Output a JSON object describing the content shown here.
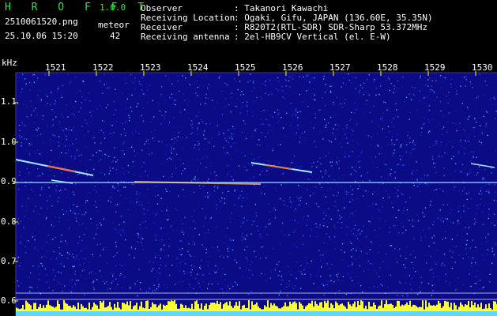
{
  "header": {
    "app_title": "H R O F F T",
    "version": "1.0.0",
    "filename": "2510061520.png",
    "datetime": "25.10.06 15:20",
    "meteor_label": "meteor",
    "meteor_count": "42"
  },
  "info": [
    {
      "label": "Observer",
      "value": ": Takanori Kawachi"
    },
    {
      "label": "Receiving Location",
      "value": ": Ogaki, Gifu, JAPAN (136.60E, 35.35N)"
    },
    {
      "label": "Receiver",
      "value": ": R820T2(RTL-SDR) SDR-Sharp 53.372MHz"
    },
    {
      "label": "Receiving antenna",
      "value": ": 2el-HB9CV Vertical (el. E-W)"
    }
  ],
  "axis": {
    "unit": "kHz",
    "time_ticks": [
      "1521",
      "1522",
      "1523",
      "1524",
      "1525",
      "1526",
      "1527",
      "1528",
      "1529",
      "1530"
    ],
    "freq_ticks": [
      "1.1",
      "1.0",
      "0.9",
      "0.8",
      "0.7",
      "0.6"
    ],
    "freq_extra_ticks": [
      "0.8",
      "0.7"
    ]
  },
  "colors": {
    "background": "#000000",
    "plot_background": "#0b0b86",
    "title_green": "#38e238",
    "tick_yellow": "#ffff00",
    "trace_cyan": "#7fe6ff",
    "trace_hot": "#ff8040",
    "baseline_yellow": "#ffff33"
  }
}
